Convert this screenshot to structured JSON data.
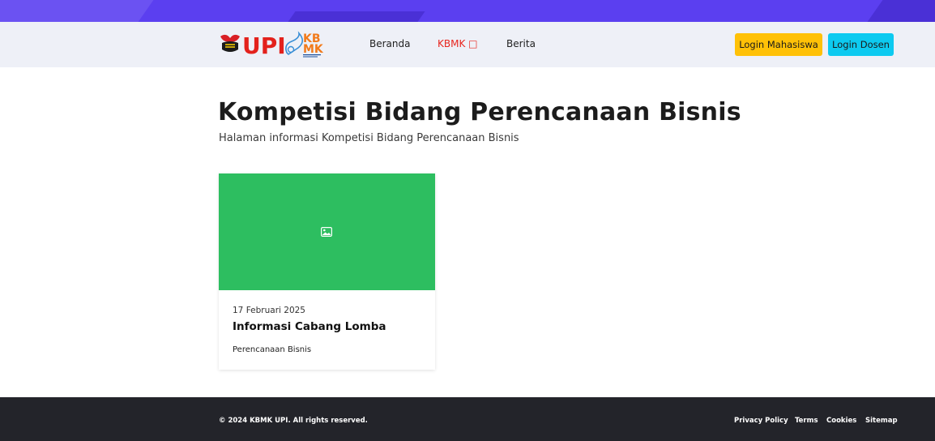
{
  "nav": {
    "items": [
      {
        "label": "Beranda"
      },
      {
        "label": "KBMK □"
      },
      {
        "label": "Berita"
      }
    ],
    "login_mahasiswa": "Login Mahasiswa",
    "login_dosen": "Login Dosen"
  },
  "logo": {
    "text_upi": "UPI",
    "text_kb": "KB",
    "text_mk": "MK"
  },
  "page": {
    "title": "Kompetisi Bidang Perencanaan Bisnis",
    "subtitle": "Halaman informasi Kompetisi Bidang Perencanaan Bisnis"
  },
  "cards": [
    {
      "date": "17 Februari 2025",
      "title": "Informasi Cabang Lomba",
      "tag": "Perencanaan Bisnis",
      "image_icon": "image-icon"
    }
  ],
  "footer": {
    "copyright": "© 2024 KBMK UPI. All rights reserved.",
    "links": [
      {
        "label": "Privacy Policy"
      },
      {
        "label": "Terms"
      },
      {
        "label": "Cookies"
      },
      {
        "label": "Sitemap"
      }
    ]
  },
  "colors": {
    "topbar": "#5b3ff0",
    "navbar_bg": "#eef0f7",
    "active_link": "#e8261f",
    "btn_mahasiswa": "#ffc107",
    "btn_dosen": "#0dcaf0",
    "card_image": "#2dbe60",
    "footer_bg": "#23242a"
  }
}
